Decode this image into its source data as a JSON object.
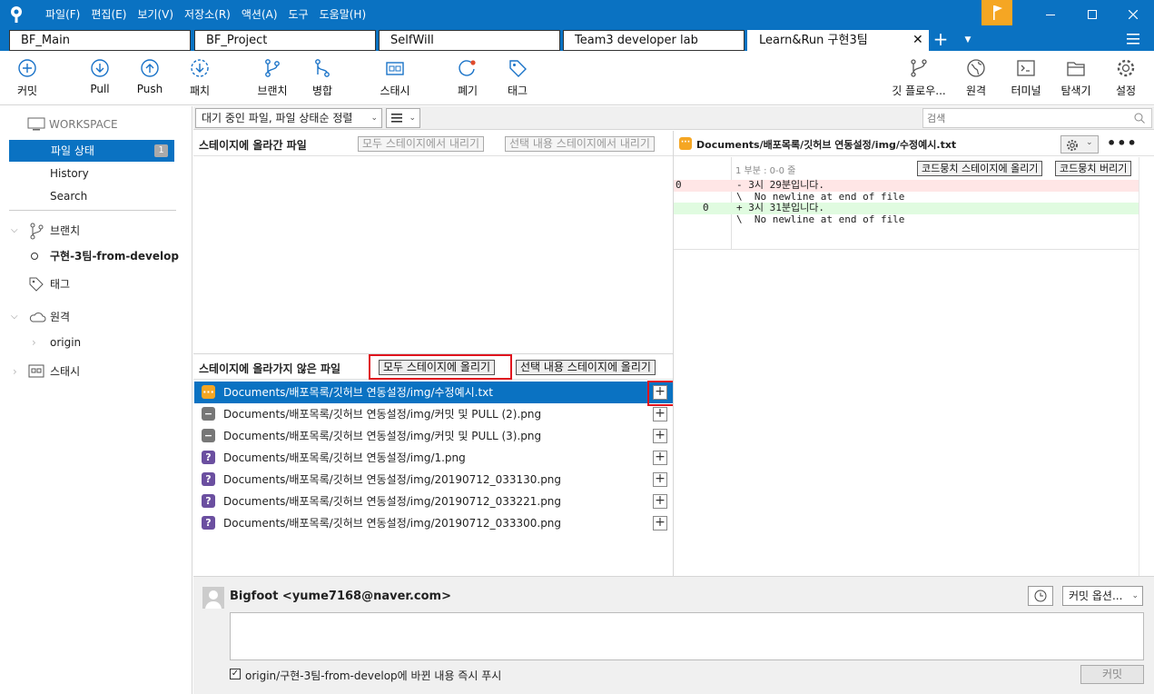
{
  "menu": [
    "파일(F)",
    "편집(E)",
    "보기(V)",
    "저장소(R)",
    "액션(A)",
    "도구",
    "도움말(H)"
  ],
  "tabs": [
    "BF_Main",
    "BF_Project",
    "SelfWill",
    "Team3 developer lab",
    "Learn&Run 구현3팀"
  ],
  "toolbar": {
    "commit": "커밋",
    "pull": "Pull",
    "push": "Push",
    "patch": "패치",
    "branch": "브랜치",
    "merge": "병합",
    "stash": "스태시",
    "discard": "폐기",
    "tag": "태그",
    "gitflow": "깃 플로우...",
    "remote": "원격",
    "terminal": "터미널",
    "explorer": "탐색기",
    "settings": "설정"
  },
  "sidebar": {
    "workspace": "WORKSPACE",
    "file_status": "파일 상태",
    "file_status_count": "1",
    "history": "History",
    "search": "Search",
    "branches": "브랜치",
    "current_branch": "구현-3팀-from-develop",
    "tags": "태그",
    "remotes": "원격",
    "origin": "origin",
    "stashes": "스태시"
  },
  "filter": {
    "sort": "대기 중인 파일, 파일 상태순 정렬",
    "search_placeholder": "검색"
  },
  "staged": {
    "title": "스테이지에 올라간 파일",
    "unstage_all": "모두 스테이지에서 내리기",
    "unstage_selected": "선택 내용 스테이지에서 내리기"
  },
  "unstaged": {
    "title": "스테이지에 올라가지 않은 파일",
    "stage_all": "모두 스테이지에 올리기",
    "stage_selected": "선택 내용 스테이지에 올리기",
    "files": [
      {
        "status": "modified",
        "icon": "···",
        "path": "Documents/배포목록/깃허브 연동설정/img/수정예시.txt"
      },
      {
        "status": "removed",
        "icon": "−",
        "path": "Documents/배포목록/깃허브 연동설정/img/커밋 및 PULL (2).png"
      },
      {
        "status": "removed",
        "icon": "−",
        "path": "Documents/배포목록/깃허브 연동설정/img/커밋 및 PULL (3).png"
      },
      {
        "status": "untracked",
        "icon": "?",
        "path": "Documents/배포목록/깃허브 연동설정/img/1.png"
      },
      {
        "status": "untracked",
        "icon": "?",
        "path": "Documents/배포목록/깃허브 연동설정/img/20190712_033130.png"
      },
      {
        "status": "untracked",
        "icon": "?",
        "path": "Documents/배포목록/깃허브 연동설정/img/20190712_033221.png"
      },
      {
        "status": "untracked",
        "icon": "?",
        "path": "Documents/배포목록/깃허브 연동설정/img/20190712_033300.png"
      }
    ]
  },
  "diff": {
    "file": "Documents/배포목록/깃허브 연동설정/img/수정예시.txt",
    "hunk": "1 부분 : 0-0 줄",
    "stage_hunk": "코드뭉치 스테이지에 올리기",
    "discard_hunk": "코드뭉치 버리기",
    "lines": [
      {
        "old": "0",
        "new": "",
        "type": "del",
        "text": "- 3시 29분입니다."
      },
      {
        "old": "",
        "new": "",
        "type": "ctx",
        "text": "\\  No newline at end of file"
      },
      {
        "old": "",
        "new": "0",
        "type": "add",
        "text": "+ 3시 31분입니다."
      },
      {
        "old": "",
        "new": "",
        "type": "ctx",
        "text": "\\  No newline at end of file"
      }
    ]
  },
  "commit": {
    "author": "Bigfoot <yume7168@naver.com>",
    "options": "커밋 옵션...",
    "push_label": "origin/구현-3팀-from-develop에 바뀐 내용 즉시 푸시",
    "commit_button": "커밋"
  },
  "colors": {
    "titlebar": "#0a72c2",
    "selection": "#0a72c2",
    "highlight_box": "#e0141e",
    "modified": "#f5a623",
    "removed": "#777777",
    "untracked": "#6b4fa0"
  }
}
